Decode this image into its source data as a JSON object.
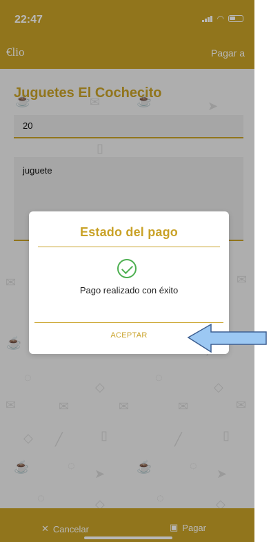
{
  "status_bar": {
    "time": "22:47"
  },
  "header": {
    "logo": "€lio",
    "action": "Pagar a"
  },
  "payment": {
    "merchant": "Juguetes El Cochecito",
    "amount": "20",
    "concept": "juguete"
  },
  "dialog": {
    "title": "Estado del pago",
    "message": "Pago realizado con éxito",
    "accept_label": "ACEPTAR"
  },
  "footer": {
    "cancel_label": "Cancelar",
    "pay_label": "Pagar"
  },
  "colors": {
    "brand": "#c9a227",
    "success": "#4caf50",
    "arrow_fill": "#9cc8f3",
    "arrow_stroke": "#3d5f91"
  },
  "icons": [
    "signal-icon",
    "wifi-icon",
    "battery-icon",
    "check-icon",
    "cancel-icon",
    "pay-icon",
    "arrow-icon"
  ]
}
